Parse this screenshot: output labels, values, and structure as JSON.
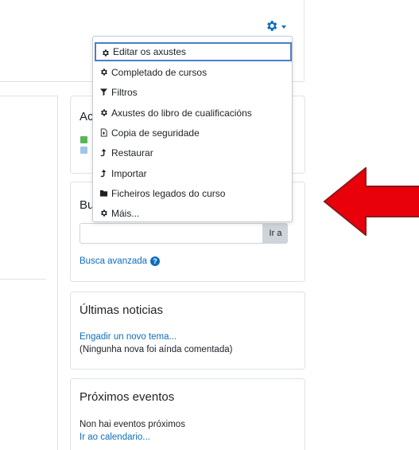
{
  "settings_menu": {
    "trigger_icon": "gear-icon",
    "items": [
      {
        "label": "Editar os axustes",
        "icon": "gear-icon",
        "active": true
      },
      {
        "label": "Completado de cursos",
        "icon": "gear-icon"
      },
      {
        "label": "Filtros",
        "icon": "filter-icon"
      },
      {
        "label": "Axustes do libro de cualificacións",
        "icon": "gear-icon"
      },
      {
        "label": "Copia de seguridade",
        "icon": "file-archive-icon"
      },
      {
        "label": "Restaurar",
        "icon": "upload-icon"
      },
      {
        "label": "Importar",
        "icon": "upload-icon"
      },
      {
        "label": "Ficheiros legados do curso",
        "icon": "folder-icon"
      },
      {
        "label": "Máis...",
        "icon": "gear-icon"
      }
    ]
  },
  "blocks": {
    "activities": {
      "title": "Ac"
    },
    "search": {
      "title": "Bu",
      "button": "Ir a",
      "advanced_link": "Busca avanzada"
    },
    "news": {
      "title": "Últimas noticias",
      "add_link": "Engadir un novo tema...",
      "empty_text": "(Ningunha nova foi aínda comentada)"
    },
    "events": {
      "title": "Próximos eventos",
      "empty_text": "Non hai eventos próximos",
      "calendar_link": "Ir ao calendario..."
    }
  },
  "colors": {
    "accent": "#0f6cbf",
    "annotation_arrow": "#e8000b",
    "highlight_border": "#4a7fc7"
  }
}
